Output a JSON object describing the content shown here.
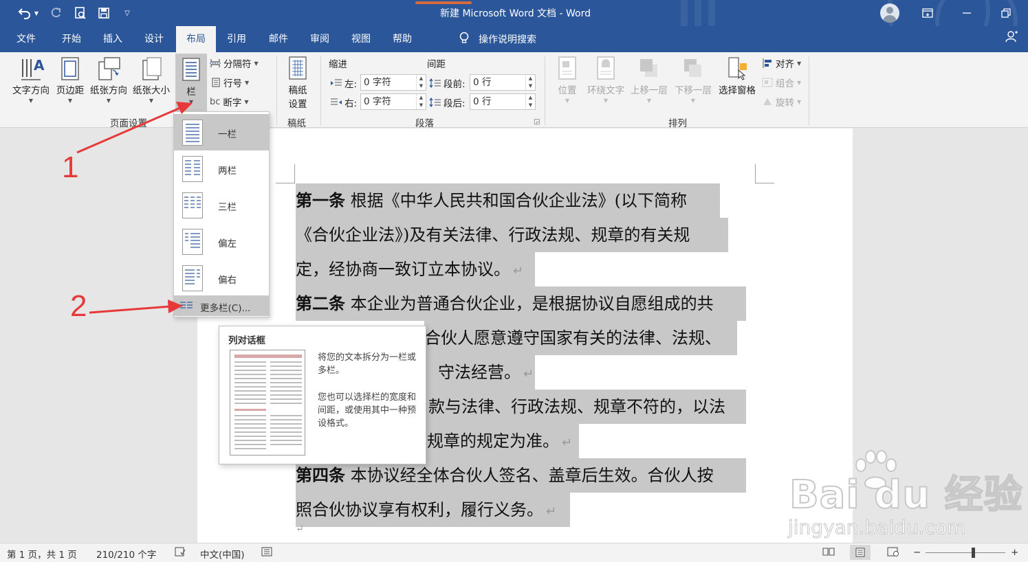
{
  "colors": {
    "brand": "#2b579a",
    "annotation": "#e8393a",
    "highlight": "#c8c8c8"
  },
  "title_bar": {
    "title": "新建 Microsoft Word 文档  -  Word",
    "qat": {
      "undo_icon": "undo-icon",
      "redo_icon": "redo-icon",
      "print_preview_icon": "print-preview-icon",
      "save_icon": "save-icon",
      "customize_icon": "customize-qat-icon"
    },
    "window_buttons": {
      "ribbon_display": "ribbon-display-icon",
      "minimize": "minimize-icon",
      "restore": "restore-icon"
    }
  },
  "tabs": {
    "file": "文件",
    "home": "开始",
    "insert": "插入",
    "design": "设计",
    "layout": "布局",
    "references": "引用",
    "mailings": "邮件",
    "review": "审阅",
    "view": "视图",
    "help": "帮助",
    "tell_me": "操作说明搜索"
  },
  "ribbon": {
    "page_setup": {
      "label": "页面设置",
      "text_direction": "文字方向",
      "margins": "页边距",
      "orientation": "纸张方向",
      "size": "纸张大小",
      "columns": "栏",
      "breaks": "分隔符",
      "line_numbers": "行号",
      "hyphenation": "断字"
    },
    "manuscript": {
      "label": "稿纸",
      "button_line1": "稿纸",
      "button_line2": "设置"
    },
    "paragraph": {
      "label": "段落",
      "indent_header": "缩进",
      "spacing_header": "间距",
      "left_label": "左:",
      "right_label": "右:",
      "before_label": "段前:",
      "after_label": "段后:",
      "left_value": "0 字符",
      "right_value": "0 字符",
      "before_value": "0 行",
      "after_value": "0 行"
    },
    "arrange": {
      "label": "排列",
      "position": "位置",
      "wrap_text": "环绕文字",
      "bring_forward": "上移一层",
      "send_backward": "下移一层",
      "selection_pane": "选择窗格",
      "align": "对齐",
      "group": "组合",
      "rotate": "旋转"
    }
  },
  "columns_menu": {
    "items": [
      "一栏",
      "两栏",
      "三栏",
      "偏左",
      "偏右"
    ],
    "more": "更多栏(C)..."
  },
  "tooltip": {
    "title": "列对话框",
    "text1": "将您的文本拆分为一栏或多栏。",
    "text2": "您也可以选择栏的宽度和间距，或使用其中一种预设格式。"
  },
  "document": {
    "lines": [
      {
        "bold": "第一条",
        "text": " 根据《中华人民共和国合伙企业法》(以下简称"
      },
      {
        "bold": "",
        "text": "《合伙企业法》)及有关法律、行政法规、规章的有关规"
      },
      {
        "bold": "",
        "text": "定，经协商一致订立本协议。",
        "mark": "↵"
      },
      {
        "bold": "第二条",
        "text": " 本企业为普通合伙企业，是根据协议自愿组成的共"
      },
      {
        "bold": "",
        "text": "合伙人愿意遵守国家有关的法律、法规、"
      },
      {
        "bold": "",
        "text": "守法经营。",
        "mark": "↵"
      },
      {
        "bold": "",
        "text": "款与法律、行政法规、规章不符的，以法"
      },
      {
        "bold": "",
        "text": "规章的规定为准。",
        "mark": "↵"
      },
      {
        "bold": "第四条",
        "text": " 本协议经全体合伙人签名、盖章后生效。合伙人按"
      },
      {
        "bold": "",
        "text": "照合伙协议享有权利，履行义务。",
        "mark": "↵"
      }
    ],
    "end_mark": "↵"
  },
  "annotations": {
    "step1": "1",
    "step2": "2"
  },
  "status_bar": {
    "page": "第 1 页，共 1 页",
    "words": "210/210 个字",
    "language": "中文(中国)",
    "zoom_minus": "−",
    "zoom_plus": "+",
    "zoom_level": 0.6
  },
  "watermark": {
    "main": "Bai du 经验",
    "sub": "jingyan.baidu.com"
  }
}
